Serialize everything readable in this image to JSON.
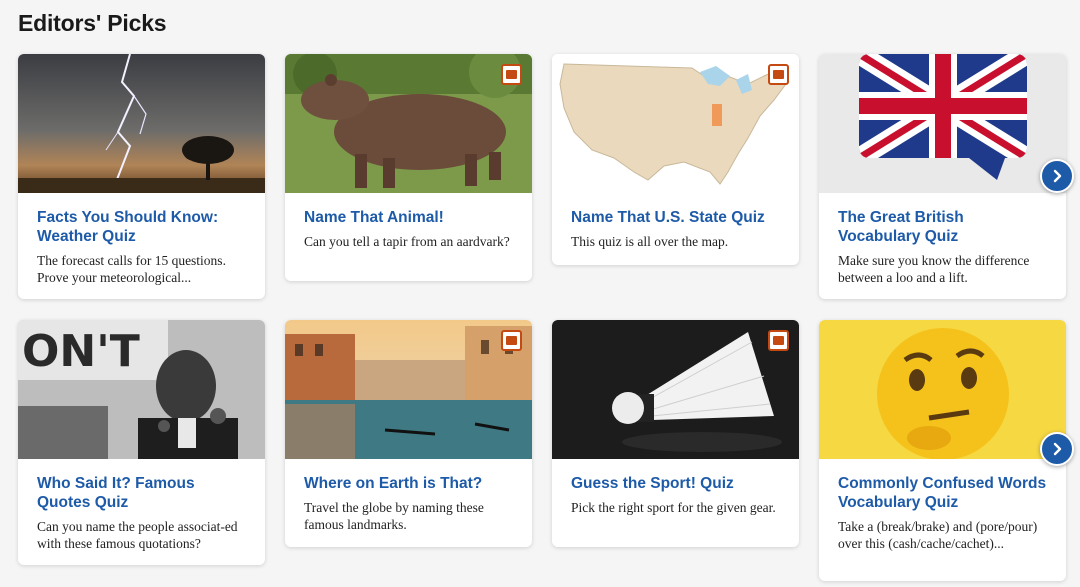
{
  "section": {
    "title": "Editors' Picks"
  },
  "row1": [
    {
      "title": "Facts You Should Know: Weather Quiz",
      "desc": "The forecast calls for 15 questions. Prove your meteorological...",
      "image": "lightning-storm-image",
      "badge": false
    },
    {
      "title": "Name That Animal!",
      "desc": "Can you tell a tapir from an aardvark?",
      "image": "capybara-image",
      "badge": true
    },
    {
      "title": "Name That U.S. State Quiz",
      "desc": "This quiz is all over the map.",
      "image": "us-map-image",
      "badge": true
    },
    {
      "title": "The Great British Vocabulary Quiz",
      "desc": "Make sure you know the difference between a loo and a lift.",
      "image": "union-jack-speech-bubble-image",
      "badge": false
    }
  ],
  "row2": [
    {
      "title": "Who Said It? Famous Quotes Quiz",
      "desc": "Can you name the people associat-ed with these famous quotations?",
      "image": "speaker-at-microphones-image",
      "badge": false
    },
    {
      "title": "Where on Earth is That?",
      "desc": "Travel the globe by naming these famous landmarks.",
      "image": "venice-canal-image",
      "badge": true
    },
    {
      "title": "Guess the Sport! Quiz",
      "desc": "Pick the right sport for the given gear.",
      "image": "shuttlecock-image",
      "badge": true
    },
    {
      "title": "Commonly Confused Words Vocabulary Quiz",
      "desc": "Take a (break/brake) and (pore/pour) over this (cash/cache/cachet)...",
      "image": "thinking-face-emoji-image",
      "badge": false
    }
  ],
  "controls": {
    "next_icon": "chevron-right-icon",
    "badge_icon": "image-icon"
  },
  "colors": {
    "title_blue": "#1d5aa8",
    "badge_orange": "#c44a12",
    "background": "#f5f5f5"
  }
}
